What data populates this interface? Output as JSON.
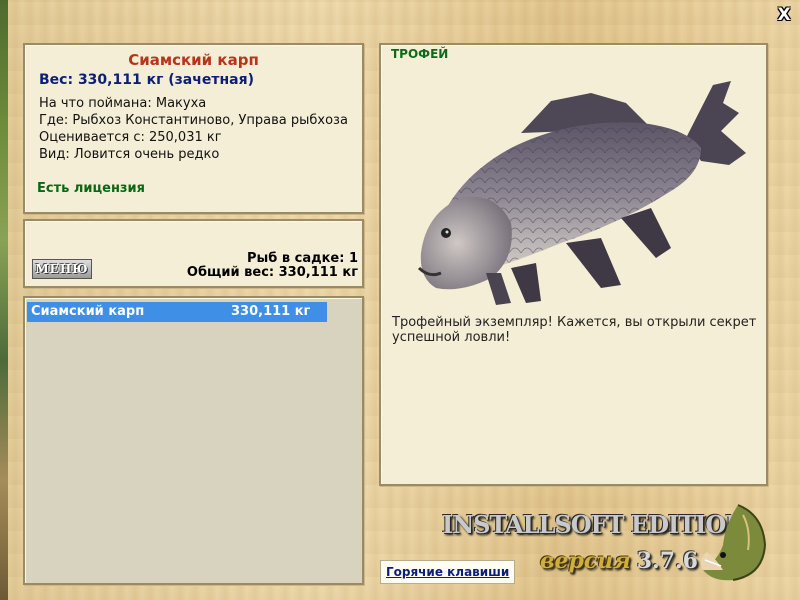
{
  "window": {
    "close_label": "X"
  },
  "info": {
    "fish_name": "Сиамский карп",
    "weight_line": "Вес: 330,111 кг (зачетная)",
    "bait_line": "На что поймана: Макуха",
    "location_line": "Где: Рыбхоз Константиново, Управа рыбхоза",
    "scored_line": "Оценивается с: 250,031 кг",
    "rarity_line": "Вид: Ловится очень редко",
    "license": "Есть лицензия"
  },
  "cage": {
    "menu_label": "МЕНЮ",
    "count": "Рыб в садке: 1",
    "total_weight": "Общий вес: 330,111 кг"
  },
  "catch_list": {
    "items": [
      {
        "name": "Сиамский карп",
        "weight": "330,111 кг",
        "selected": true
      }
    ]
  },
  "trophy": {
    "label": "ТРОФЕЙ",
    "image": "siamese-carp",
    "text": "Трофейный экземпляр! Кажется, вы открыли секрет успешной ловли!"
  },
  "footer": {
    "edition": "INSTALLSOFT EDITION",
    "version_word": "версия",
    "version_number": "3.7.6",
    "hotkeys": "Горячие клавиши",
    "logo": "pike-logo"
  },
  "colors": {
    "title_red": "#b6351b",
    "weight_blue": "#0c1f78",
    "license_green": "#0c6613",
    "selection_blue": "#3f8fe6"
  }
}
